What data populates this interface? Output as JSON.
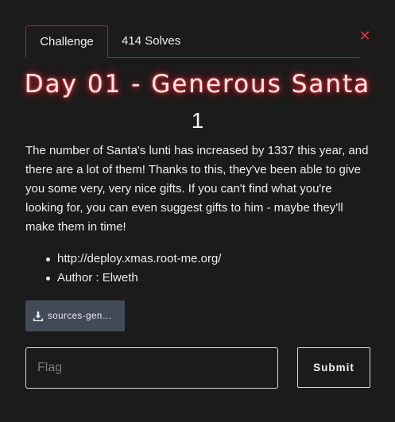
{
  "tabs": [
    {
      "label": "Challenge",
      "active": true
    },
    {
      "label": "414 Solves",
      "active": false
    }
  ],
  "close_icon": "close-icon",
  "challenge": {
    "title": "Day 01 - Generous Santa",
    "points": "1",
    "description": "The number of Santa's lunti has increased by 1337 this year, and there are a lot of them! Thanks to this, they've been able to give you some very, very nice gifts. If you can't find what you're looking for, you can even suggest gifts to him - maybe they'll make them in time!",
    "bullets": [
      "http://deploy.xmas.root-me.org/",
      "Author : Elweth"
    ],
    "file_label": "sources-gen…",
    "file_icon": "download-icon"
  },
  "submission": {
    "flag_placeholder": "Flag",
    "flag_value": "",
    "submit_label": "Submit"
  },
  "colors": {
    "accent": "#b0232b",
    "title_glow": "#e0262e",
    "file_button_bg": "#434a57",
    "background": "#1b1b1b"
  }
}
